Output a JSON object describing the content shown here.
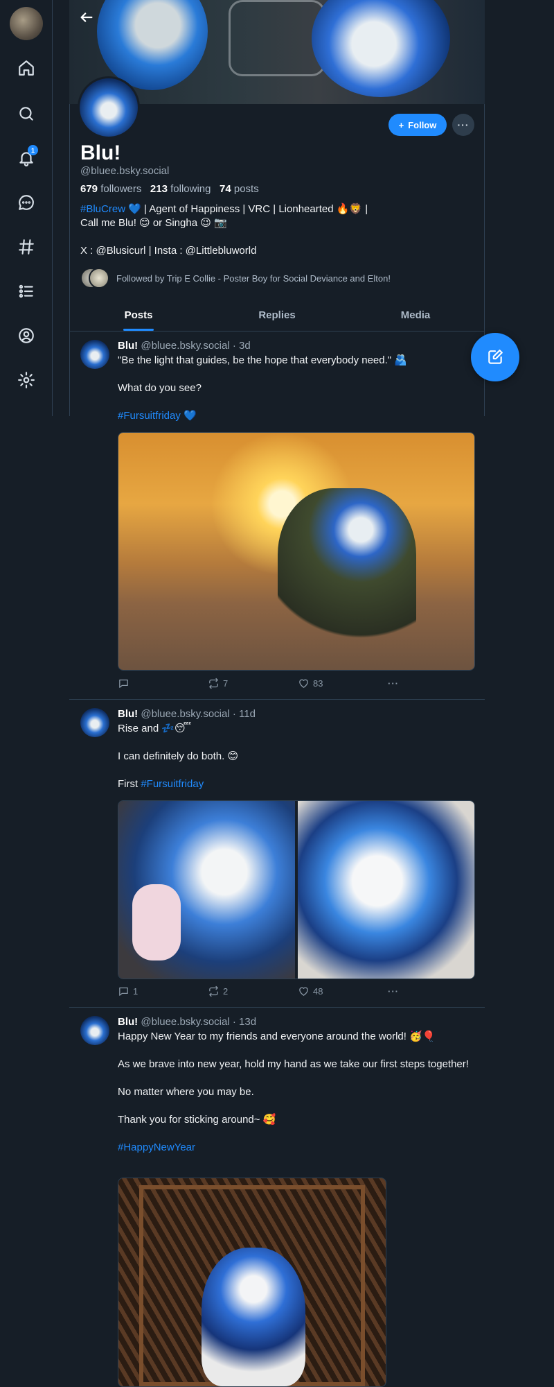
{
  "nav": {
    "notification_count": "1",
    "icons": [
      "home-icon",
      "search-icon",
      "bell-icon",
      "chat-icon",
      "hashtag-icon",
      "lists-icon",
      "profile-icon",
      "settings-icon"
    ]
  },
  "profile": {
    "display_name": "Blu!",
    "handle": "@bluee.bsky.social",
    "followers_count": "679",
    "followers_label": "followers",
    "following_count": "213",
    "following_label": "following",
    "posts_count": "74",
    "posts_label": "posts",
    "follow_label": "Follow",
    "bio_tag": "#BluCrew",
    "bio_line1_rest": " 💙 | Agent of Happiness | VRC | Lionhearted 🔥🦁 |",
    "bio_line2": "Call me Blu! 😊 or Singha 😉 📷",
    "bio_line3": "X : @Blusicurl | Insta : @Littlebluworld",
    "followed_by": "Followed by Trip E Collie - Poster Boy for Social Deviance and Elton!"
  },
  "tabs": [
    {
      "label": "Posts"
    },
    {
      "label": "Replies"
    },
    {
      "label": "Media"
    }
  ],
  "posts": [
    {
      "author": "Blu!",
      "meta": "@bluee.bsky.social · 3d",
      "line1": "\"Be the light that guides, be the hope that everybody need.\" 🫂",
      "line2": "What do you see?",
      "tag": "#Fursuitfriday",
      "tag_suffix": " 💙",
      "replies": "",
      "reposts": "7",
      "likes": "83"
    },
    {
      "author": "Blu!",
      "meta": "@bluee.bsky.social · 11d",
      "line1": "Rise and 💤😴",
      "line2": "I can definitely do both. 😊",
      "prefix": "First ",
      "tag": "#Fursuitfriday",
      "replies": "1",
      "reposts": "2",
      "likes": "48"
    },
    {
      "author": "Blu!",
      "meta": "@bluee.bsky.social · 13d",
      "line1": "Happy New Year to my friends and everyone around the world! 🥳🎈",
      "line2": "As we brave into new year, hold my hand as we take our first steps together!",
      "line3": "No matter where you may be.",
      "line4": "Thank you for sticking around~ 🥰",
      "tag": "#HappyNewYear"
    }
  ],
  "colors": {
    "background": "#161e27",
    "accent": "#208bfe",
    "border": "#2e4052",
    "muted": "#9aa7b4"
  }
}
